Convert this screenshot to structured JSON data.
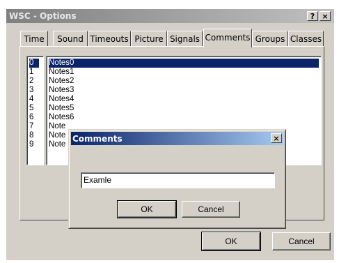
{
  "window": {
    "title": "WSC - Options",
    "help_label": "?",
    "close_label": "×"
  },
  "tabs": [
    "Time",
    "Sound",
    "Timeouts",
    "Picture",
    "Signals",
    "Comments",
    "Groups",
    "Classes"
  ],
  "active_tab": "Comments",
  "numbers": [
    "0",
    "1",
    "2",
    "3",
    "4",
    "5",
    "6",
    "7",
    "8",
    "9"
  ],
  "notes": [
    "Notes0",
    "Notes1",
    "Notes2",
    "Notes3",
    "Notes4",
    "Notes5",
    "Notes6",
    "Note",
    "Note",
    "Note"
  ],
  "selected_index": 0,
  "main_buttons": {
    "ok": "OK",
    "cancel": "Cancel"
  },
  "dialog": {
    "title": "Comments",
    "close_label": "×",
    "input_value": "Examle",
    "ok": "OK",
    "cancel": "Cancel"
  },
  "colors": {
    "selection": "#0a246a",
    "face": "#d4d0c8"
  }
}
